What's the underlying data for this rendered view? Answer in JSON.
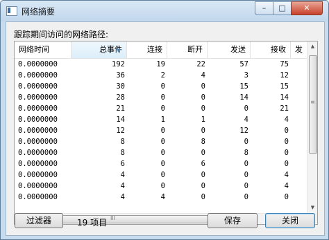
{
  "window": {
    "title": "网络摘要",
    "minimize": "–",
    "maximize": "□",
    "close": "✕"
  },
  "label": "跟踪期间访问的网络路径:",
  "columns": [
    "网络时间",
    "总事件",
    "连接",
    "断开",
    "发送",
    "接收",
    "发"
  ],
  "rows": [
    [
      "0.0000000",
      "192",
      "19",
      "22",
      "57",
      "75"
    ],
    [
      "0.0000000",
      "36",
      "2",
      "4",
      "3",
      "12"
    ],
    [
      "0.0000000",
      "30",
      "0",
      "0",
      "15",
      "15"
    ],
    [
      "0.0000000",
      "28",
      "0",
      "0",
      "14",
      "14"
    ],
    [
      "0.0000000",
      "21",
      "0",
      "0",
      "0",
      "21"
    ],
    [
      "0.0000000",
      "14",
      "1",
      "1",
      "4",
      "4"
    ],
    [
      "0.0000000",
      "12",
      "0",
      "0",
      "12",
      "0"
    ],
    [
      "0.0000000",
      "8",
      "0",
      "8",
      "0",
      "0"
    ],
    [
      "0.0000000",
      "8",
      "0",
      "0",
      "8",
      "0"
    ],
    [
      "0.0000000",
      "6",
      "0",
      "6",
      "0",
      "0"
    ],
    [
      "0.0000000",
      "4",
      "0",
      "0",
      "0",
      "4"
    ],
    [
      "0.0000000",
      "4",
      "0",
      "0",
      "0",
      "4"
    ],
    [
      "0.0000000",
      "4",
      "4",
      "0",
      "0",
      "0"
    ]
  ],
  "sorted_column": "总事件",
  "buttons": {
    "filter": "过滤器",
    "save": "保存",
    "close": "关闭"
  },
  "item_count": "19 项目",
  "scroll_glyphs": {
    "up": "▲",
    "down": "▼",
    "left": "◀",
    "right": "▶",
    "grip_v": "≡",
    "grip_h": "III"
  }
}
